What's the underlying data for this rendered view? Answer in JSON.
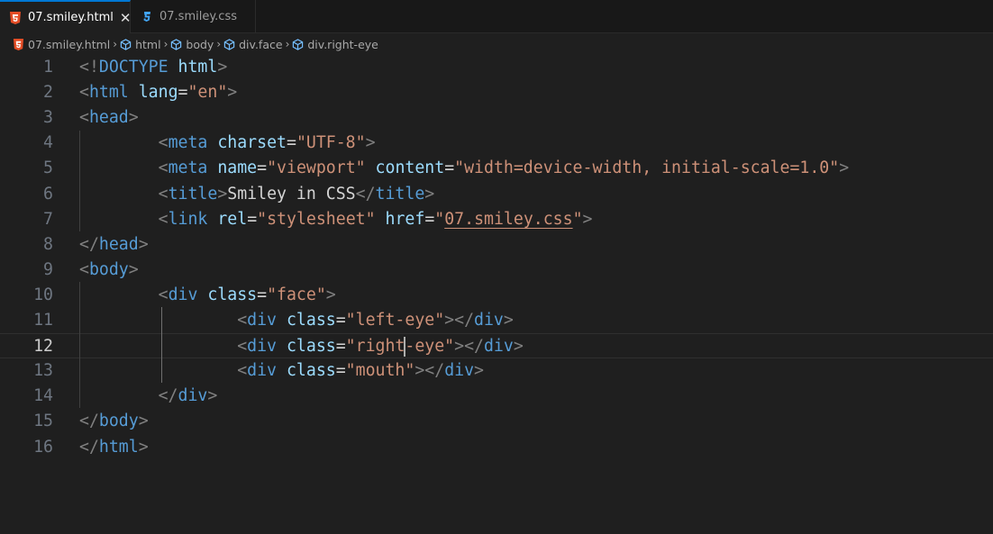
{
  "tabs": [
    {
      "label": "07.smiley.html",
      "icon": "html5-icon",
      "active": true,
      "close": "✕"
    },
    {
      "label": "07.smiley.css",
      "icon": "css3-icon",
      "active": false
    }
  ],
  "breadcrumb": [
    {
      "label": "07.smiley.html",
      "icon": "html5-icon"
    },
    {
      "label": "html",
      "icon": "cube-icon"
    },
    {
      "label": "body",
      "icon": "cube-icon"
    },
    {
      "label": "div.face",
      "icon": "cube-icon"
    },
    {
      "label": "div.right-eye",
      "icon": "cube-icon"
    }
  ],
  "editor": {
    "current_line": 12,
    "lines": [
      {
        "n": "1",
        "t": [
          [
            "pun",
            "<!"
          ],
          [
            "tag",
            "DOCTYPE"
          ],
          [
            "txt",
            " "
          ],
          [
            "attr",
            "html"
          ],
          [
            "pun",
            ">"
          ]
        ]
      },
      {
        "n": "2",
        "t": [
          [
            "pun",
            "<"
          ],
          [
            "tag",
            "html"
          ],
          [
            "txt",
            " "
          ],
          [
            "attr",
            "lang"
          ],
          [
            "txt",
            "="
          ],
          [
            "str",
            "\"en\""
          ],
          [
            "pun",
            ">"
          ]
        ]
      },
      {
        "n": "3",
        "t": [
          [
            "pun",
            "<"
          ],
          [
            "tag",
            "head"
          ],
          [
            "pun",
            ">"
          ]
        ]
      },
      {
        "n": "4",
        "t": [
          [
            "txt",
            "        "
          ],
          [
            "pun",
            "<"
          ],
          [
            "tag",
            "meta"
          ],
          [
            "txt",
            " "
          ],
          [
            "attr",
            "charset"
          ],
          [
            "txt",
            "="
          ],
          [
            "str",
            "\"UTF-8\""
          ],
          [
            "pun",
            ">"
          ]
        ]
      },
      {
        "n": "5",
        "t": [
          [
            "txt",
            "        "
          ],
          [
            "pun",
            "<"
          ],
          [
            "tag",
            "meta"
          ],
          [
            "txt",
            " "
          ],
          [
            "attr",
            "name"
          ],
          [
            "txt",
            "="
          ],
          [
            "str",
            "\"viewport\""
          ],
          [
            "txt",
            " "
          ],
          [
            "attr",
            "content"
          ],
          [
            "txt",
            "="
          ],
          [
            "str",
            "\"width=device-width, initial-scale=1.0\""
          ],
          [
            "pun",
            ">"
          ]
        ]
      },
      {
        "n": "6",
        "t": [
          [
            "txt",
            "        "
          ],
          [
            "pun",
            "<"
          ],
          [
            "tag",
            "title"
          ],
          [
            "pun",
            ">"
          ],
          [
            "txt",
            "Smiley in CSS"
          ],
          [
            "pun",
            "</"
          ],
          [
            "tag",
            "title"
          ],
          [
            "pun",
            ">"
          ]
        ]
      },
      {
        "n": "7",
        "t": [
          [
            "txt",
            "        "
          ],
          [
            "pun",
            "<"
          ],
          [
            "tag",
            "link"
          ],
          [
            "txt",
            " "
          ],
          [
            "attr",
            "rel"
          ],
          [
            "txt",
            "="
          ],
          [
            "str",
            "\"stylesheet\""
          ],
          [
            "txt",
            " "
          ],
          [
            "attr",
            "href"
          ],
          [
            "txt",
            "="
          ],
          [
            "str",
            "\""
          ],
          [
            "link",
            "07.smiley.css"
          ],
          [
            "str",
            "\""
          ],
          [
            "pun",
            ">"
          ]
        ]
      },
      {
        "n": "8",
        "t": [
          [
            "pun",
            "</"
          ],
          [
            "tag",
            "head"
          ],
          [
            "pun",
            ">"
          ]
        ]
      },
      {
        "n": "9",
        "t": [
          [
            "pun",
            "<"
          ],
          [
            "tag",
            "body"
          ],
          [
            "pun",
            ">"
          ]
        ]
      },
      {
        "n": "10",
        "t": [
          [
            "txt",
            "        "
          ],
          [
            "pun",
            "<"
          ],
          [
            "tag",
            "div"
          ],
          [
            "txt",
            " "
          ],
          [
            "attr",
            "class"
          ],
          [
            "txt",
            "="
          ],
          [
            "str",
            "\"face\""
          ],
          [
            "pun",
            ">"
          ]
        ]
      },
      {
        "n": "11",
        "t": [
          [
            "txt",
            "                "
          ],
          [
            "pun",
            "<"
          ],
          [
            "tag",
            "div"
          ],
          [
            "txt",
            " "
          ],
          [
            "attr",
            "class"
          ],
          [
            "txt",
            "="
          ],
          [
            "str",
            "\"left-eye\""
          ],
          [
            "pun",
            "></"
          ],
          [
            "tag",
            "div"
          ],
          [
            "pun",
            ">"
          ]
        ]
      },
      {
        "n": "12",
        "t": [
          [
            "txt",
            "                "
          ],
          [
            "pun",
            "<"
          ],
          [
            "tag",
            "div"
          ],
          [
            "txt",
            " "
          ],
          [
            "attr",
            "class"
          ],
          [
            "txt",
            "="
          ],
          [
            "str",
            "\"right"
          ],
          [
            "cursor",
            ""
          ],
          [
            "str",
            "-eye\""
          ],
          [
            "pun",
            "></"
          ],
          [
            "tag",
            "div"
          ],
          [
            "pun",
            ">"
          ]
        ]
      },
      {
        "n": "13",
        "t": [
          [
            "txt",
            "                "
          ],
          [
            "pun",
            "<"
          ],
          [
            "tag",
            "div"
          ],
          [
            "txt",
            " "
          ],
          [
            "attr",
            "class"
          ],
          [
            "txt",
            "="
          ],
          [
            "str",
            "\"mouth\""
          ],
          [
            "pun",
            "></"
          ],
          [
            "tag",
            "div"
          ],
          [
            "pun",
            ">"
          ]
        ]
      },
      {
        "n": "14",
        "t": [
          [
            "txt",
            "        "
          ],
          [
            "pun",
            "</"
          ],
          [
            "tag",
            "div"
          ],
          [
            "pun",
            ">"
          ]
        ]
      },
      {
        "n": "15",
        "t": [
          [
            "pun",
            "</"
          ],
          [
            "tag",
            "body"
          ],
          [
            "pun",
            ">"
          ]
        ]
      },
      {
        "n": "16",
        "t": [
          [
            "pun",
            "</"
          ],
          [
            "tag",
            "html"
          ],
          [
            "pun",
            ">"
          ]
        ]
      }
    ]
  }
}
